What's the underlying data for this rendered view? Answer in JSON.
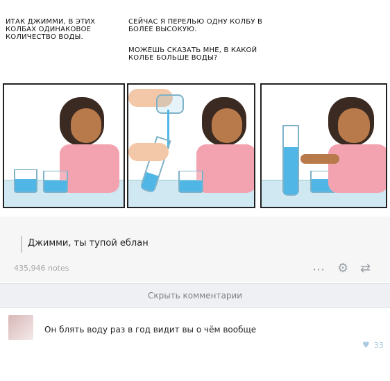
{
  "comic": {
    "caption_left": "ИТАК ДЖИММИ, В ЭТИХ КОЛБАХ ОДИНАКОВОЕ КОЛИЧЕСТВО ВОДЫ.",
    "caption_right": "СЕЙЧАС Я ПЕРЕЛЬЮ ОДНУ КОЛБУ В БОЛЕЕ ВЫСОКУЮ.",
    "caption_question": "МОЖЕШЬ СКАЗАТЬ МНЕ, В КАКОЙ КОЛБЕ БОЛЬШЕ ВОДЫ?"
  },
  "post": {
    "quote": "Джимми, ты тупой еблан",
    "notes": "435,946 notes"
  },
  "actions": {
    "more_icon": "ellipsis-icon",
    "settings_icon": "gear-icon",
    "reblog_icon": "reblog-icon"
  },
  "comments": {
    "toggle_label": "Скрыть комментарии",
    "items": [
      {
        "text": "Он блять воду раз в год видит вы о чём вообще",
        "likes": "33"
      }
    ]
  },
  "colors": {
    "water": "#4fb6e6",
    "button_bg": "#eef0f3",
    "heart": "#a9c9df"
  }
}
